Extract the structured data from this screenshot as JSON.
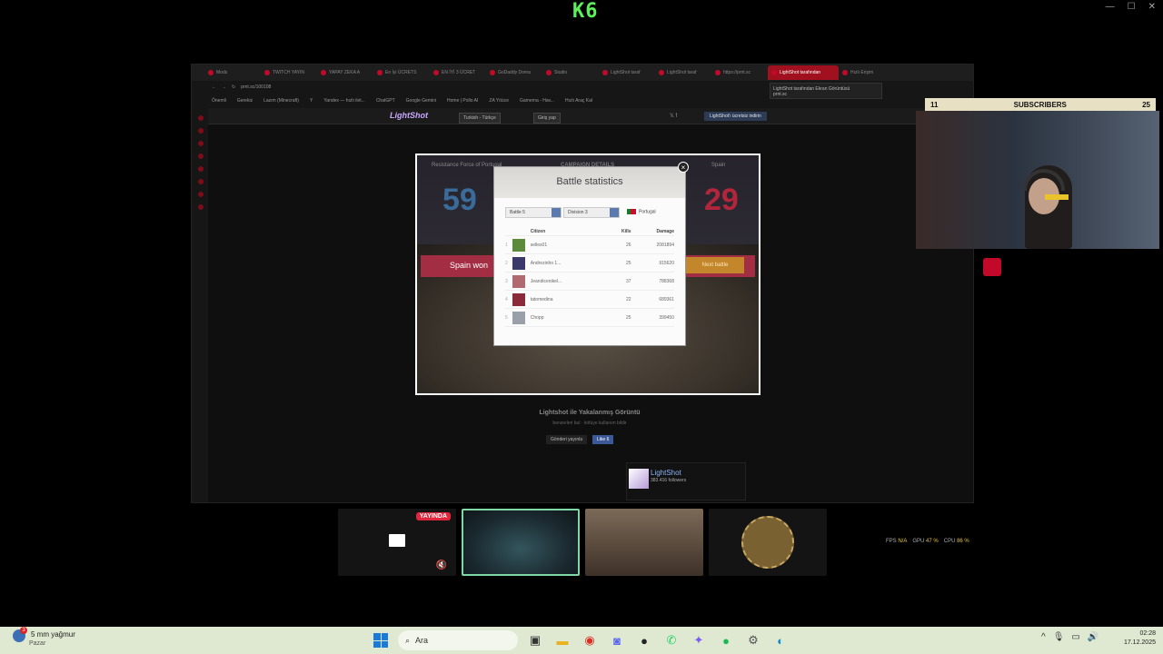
{
  "top_logo": "K6",
  "browser": {
    "tabs": [
      {
        "label": "Mods",
        "active": false
      },
      {
        "label": "TWITCH YAYIN",
        "active": false
      },
      {
        "label": "YAPAY ZEKA A",
        "active": false
      },
      {
        "label": "En İyi ÜCRETS",
        "active": false
      },
      {
        "label": "EN İYİ 3 ÜCRET",
        "active": false
      },
      {
        "label": "GoDaddy Doma",
        "active": false
      },
      {
        "label": "Studio",
        "active": false
      },
      {
        "label": "LightShot taraf",
        "active": false
      },
      {
        "label": "LightShot taraf",
        "active": false
      },
      {
        "label": "https://prnt.sc",
        "active": false
      },
      {
        "label": "LightShot tarafından",
        "active": true
      },
      {
        "label": "Hızlı Erişim",
        "active": false
      }
    ],
    "tooltip_title": "LightShot tarafından Ekran Görüntüsü",
    "tooltip_url": "prnt.sc",
    "url": "prnt.sc/100108",
    "bookmarks": [
      "Önemli",
      "Gerekiz",
      "Lazım (Minecraft)",
      "Y",
      "Yandex — hızlı ilet...",
      "ChatGPT",
      "Google Gemini",
      "Home | Pollo AI",
      "ZA Yöüce",
      "Gamerna - Hav...",
      "Hızlı Araç Kal"
    ],
    "lightshot": {
      "logo": "LightShot",
      "lang_select": "Turkish - Türkçe",
      "login": "Giriş yap",
      "download": "LightShot'ı ücretsiz indirin",
      "screenshot": {
        "faction_left": "Resistance Force of Portugal",
        "campaign_label": "CAMPAIGN DETAILS",
        "faction_right": "Spain",
        "score_left": "59",
        "score_right": "29",
        "banner_text": "Spain won",
        "next_battle": "Next battle",
        "modal": {
          "title": "Battle statistics",
          "battle_select": "Battle 5",
          "division_select": "Division 3",
          "country": "Portugal",
          "columns": [
            "Citizen",
            "Kills",
            "Damage"
          ],
          "rows": [
            {
              "rank": "1",
              "name": "selles01",
              "kills": "26",
              "damage": "2081894"
            },
            {
              "rank": "2",
              "name": "Andrezinho 1...",
              "kills": "25",
              "damage": "915620"
            },
            {
              "rank": "3",
              "name": "Jeandicenikel...",
              "kills": "37",
              "damage": "788368"
            },
            {
              "rank": "4",
              "name": "tatomedina",
              "kills": "22",
              "damage": "689361"
            },
            {
              "rank": "5",
              "name": "Chopp",
              "kills": "25",
              "damage": "399450"
            }
          ]
        }
      },
      "caption": "Lightshot ile Yakalanmış Görüntü",
      "caption_sub": "benzerleri bul · kötüye kullanım bildir",
      "share_x": "Gönderi yayınla",
      "share_fb": "Like 6",
      "card_name": "LightShot",
      "card_followers": "383.416 followers"
    },
    "perf": {
      "fps_label": "FPS",
      "fps": "N/A",
      "gpu_label": "GPU",
      "gpu": "47 %",
      "cpu_label": "CPU",
      "cpu": "86 %"
    }
  },
  "stream": {
    "subs_left": "11",
    "subs_label": "SUBSCRIBERS",
    "subs_right": "25",
    "live_badge": "YAYINDA"
  },
  "taskbar": {
    "weather": "5 mm yağmur",
    "weather_sub": "Pazar",
    "weather_badge": "3",
    "search_placeholder": "Ara",
    "time": "02:28",
    "date": "17.12.2025"
  }
}
